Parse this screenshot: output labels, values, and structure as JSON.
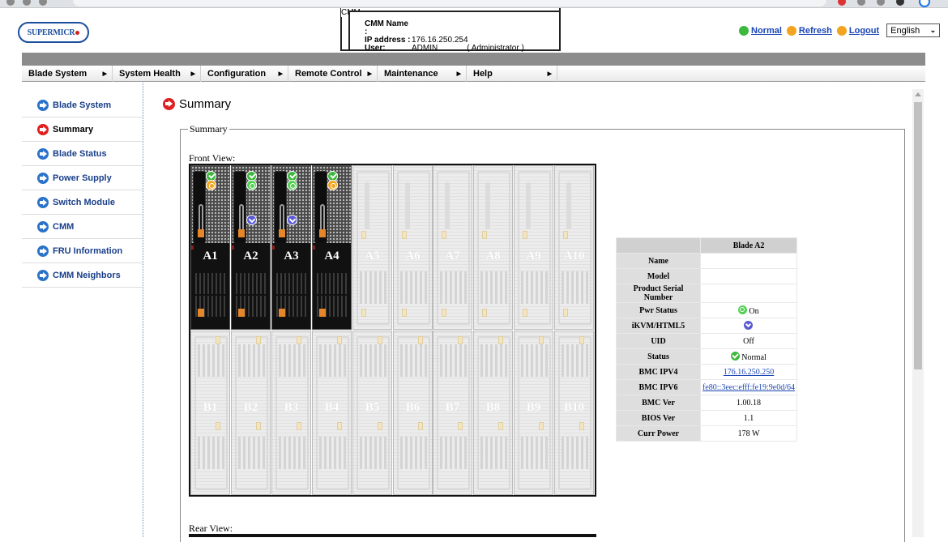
{
  "header": {
    "logo_text": "SUPERMICR",
    "cmm_box": {
      "legend": "CMM",
      "name_label": "CMM Name :",
      "name_value": "",
      "ip_label": "IP address :",
      "ip_value": "176.16.250.254",
      "user_label": "User:",
      "user_value": "ADMIN",
      "role_value": "( Administrator )"
    },
    "links": [
      {
        "label": "Normal",
        "icon": "green-check-icon",
        "color": "#3cb83c"
      },
      {
        "label": "Refresh",
        "icon": "refresh-icon",
        "color": "#f2a41e"
      },
      {
        "label": "Logout",
        "icon": "logout-icon",
        "color": "#f2a41e"
      }
    ],
    "language": "English"
  },
  "menu": [
    {
      "label": "Blade System"
    },
    {
      "label": "System Health"
    },
    {
      "label": "Configuration"
    },
    {
      "label": "Remote Control"
    },
    {
      "label": "Maintenance"
    },
    {
      "label": "Help"
    }
  ],
  "sidebar": {
    "items": [
      {
        "label": "Blade System",
        "icon": "arrow-right-circle-icon",
        "active": false
      },
      {
        "label": "Summary",
        "icon": "arrow-right-circle-icon",
        "active": true
      },
      {
        "label": "Blade Status",
        "icon": "arrow-right-circle-icon",
        "active": false
      },
      {
        "label": "Power Supply",
        "icon": "arrow-right-circle-icon",
        "active": false
      },
      {
        "label": "Switch Module",
        "icon": "arrow-right-circle-icon",
        "active": false
      },
      {
        "label": "CMM",
        "icon": "arrow-right-circle-icon",
        "active": false
      },
      {
        "label": "FRU Information",
        "icon": "arrow-right-circle-icon",
        "active": false
      },
      {
        "label": "CMM Neighbors",
        "icon": "arrow-right-circle-icon",
        "active": false
      }
    ]
  },
  "main": {
    "title": "Summary",
    "fieldset_legend": "Summary",
    "front_view_label": "Front View:",
    "rear_view_label": "Rear View:",
    "blades_top": [
      {
        "label": "A1",
        "present": true,
        "icons": [
          "ok",
          "pwr"
        ]
      },
      {
        "label": "A2",
        "present": true,
        "icons": [
          "ok",
          "pwr-green",
          "kvm"
        ]
      },
      {
        "label": "A3",
        "present": true,
        "icons": [
          "ok",
          "pwr-green",
          "kvm"
        ]
      },
      {
        "label": "A4",
        "present": true,
        "icons": [
          "ok",
          "pwr"
        ]
      },
      {
        "label": "A5",
        "present": false,
        "icons": []
      },
      {
        "label": "A6",
        "present": false,
        "icons": []
      },
      {
        "label": "A7",
        "present": false,
        "icons": []
      },
      {
        "label": "A8",
        "present": false,
        "icons": []
      },
      {
        "label": "A9",
        "present": false,
        "icons": []
      },
      {
        "label": "A10",
        "present": false,
        "icons": []
      }
    ],
    "blades_bottom": [
      {
        "label": "B1"
      },
      {
        "label": "B2"
      },
      {
        "label": "B3"
      },
      {
        "label": "B4"
      },
      {
        "label": "B5"
      },
      {
        "label": "B6"
      },
      {
        "label": "B7"
      },
      {
        "label": "B8"
      },
      {
        "label": "B9"
      },
      {
        "label": "B10"
      }
    ]
  },
  "blade_info": {
    "heading": "Blade A2",
    "rows": [
      {
        "key": "Name",
        "value": ""
      },
      {
        "key": "Model",
        "value": ""
      },
      {
        "key": "Product Serial Number",
        "value": ""
      },
      {
        "key": "Pwr Status",
        "value": "On",
        "icon": "on"
      },
      {
        "key": "iKVM/HTML5",
        "value": "",
        "icon": "kvm"
      },
      {
        "key": "UID",
        "value": "Off"
      },
      {
        "key": "Status",
        "value": "Normal",
        "icon": "ok"
      },
      {
        "key": "BMC IPV4",
        "value": "176.16.250.250",
        "link": true
      },
      {
        "key": "BMC IPV6",
        "value": "fe80::3eec:efff:fe19:9e0d/64",
        "link": true
      },
      {
        "key": "BMC Ver",
        "value": "1.00.18"
      },
      {
        "key": "BIOS Ver",
        "value": "1.1"
      },
      {
        "key": "Curr Power",
        "value": "178 W"
      }
    ]
  }
}
